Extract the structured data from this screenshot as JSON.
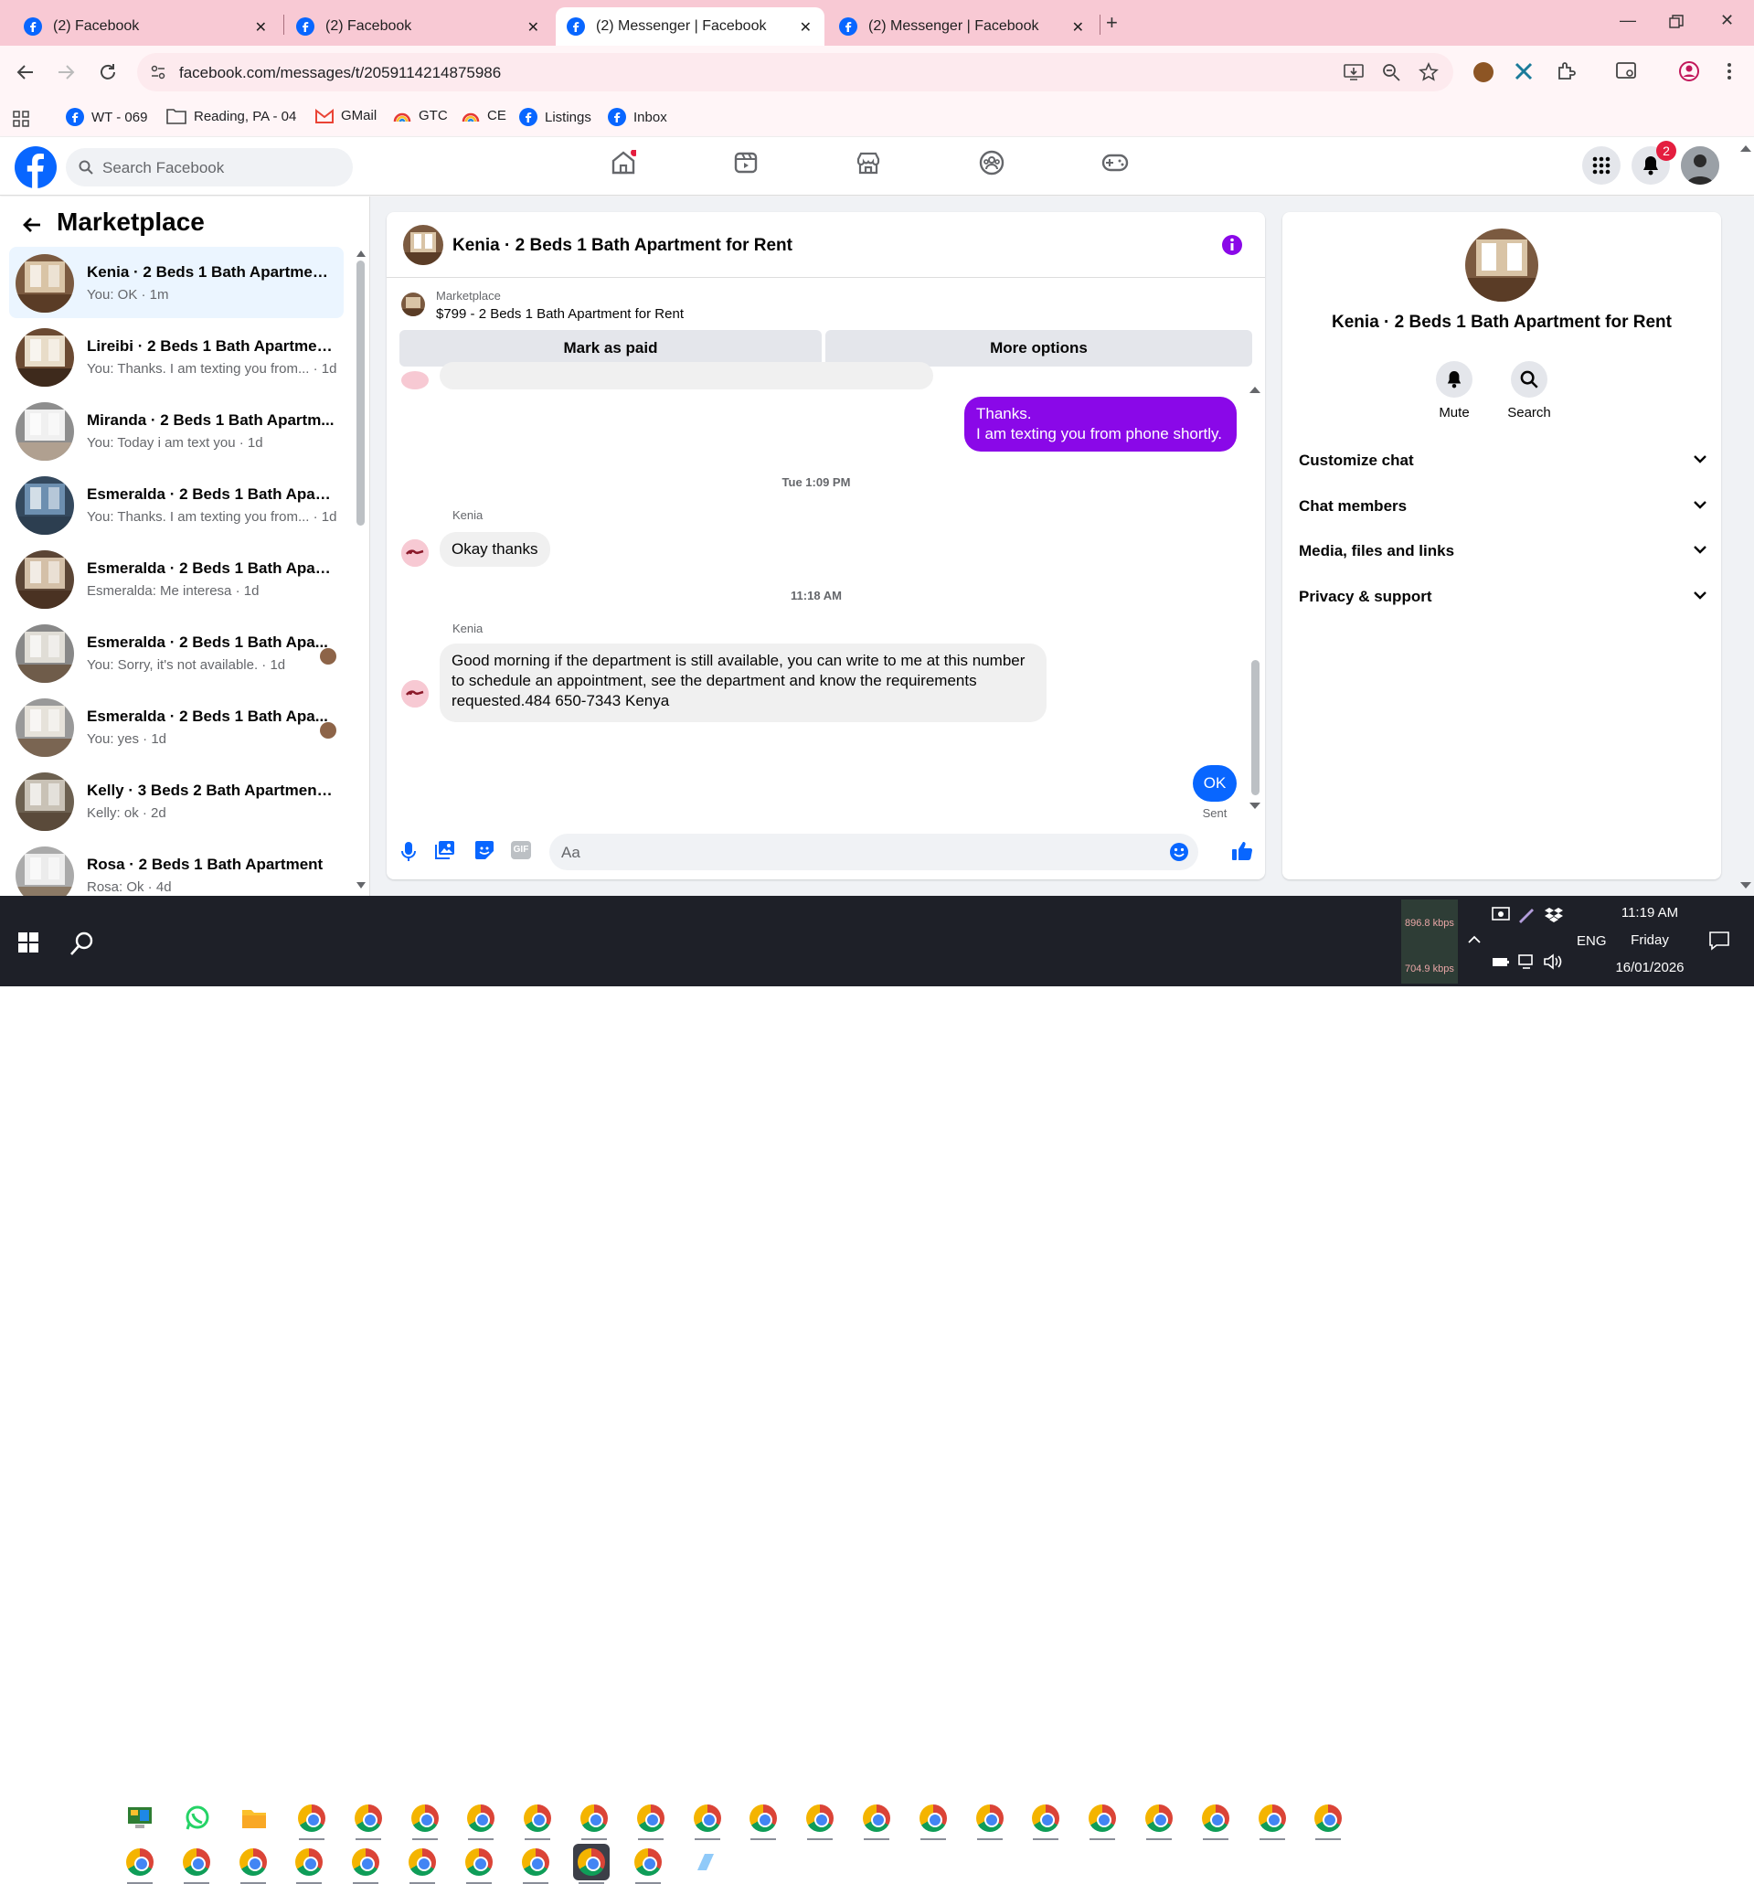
{
  "browser": {
    "tabs": [
      {
        "title": "(2) Facebook",
        "active": false
      },
      {
        "title": "(2) Facebook",
        "active": false
      },
      {
        "title": "(2) Messenger | Facebook",
        "active": true
      },
      {
        "title": "(2) Messenger | Facebook",
        "active": false
      }
    ],
    "url": "facebook.com/messages/t/2059114214875986",
    "bookmarks": [
      {
        "label": "WT - 069",
        "icon": "facebook-icon"
      },
      {
        "label": "Reading, PA - 04",
        "icon": "folder-icon"
      },
      {
        "label": "GMail",
        "icon": "gmail-icon"
      },
      {
        "label": "GTC",
        "icon": "rainbow-icon"
      },
      {
        "label": "CE",
        "icon": "rainbow-icon"
      },
      {
        "label": "Listings",
        "icon": "facebook-icon"
      },
      {
        "label": "Inbox",
        "icon": "facebook-icon"
      }
    ]
  },
  "fb_header": {
    "search_placeholder": "Search Facebook",
    "notification_count": "2"
  },
  "marketplace": {
    "title": "Marketplace",
    "conversations": [
      {
        "title": "Kenia · 2 Beds 1 Bath Apartment...",
        "snippet": "You: OK · 1m",
        "active": true
      },
      {
        "title": "Lireibi · 2 Beds 1 Bath Apartmen...",
        "snippet": "You: Thanks. I am texting you from... · 1d"
      },
      {
        "title": "Miranda · 2 Beds 1 Bath Apartm...",
        "snippet": "You: Today i am text you · 1d"
      },
      {
        "title": "Esmeralda · 2 Beds 1 Bath Apart...",
        "snippet": "You: Thanks. I am texting you from... · 1d"
      },
      {
        "title": "Esmeralda · 2 Beds 1 Bath Apart...",
        "snippet": "Esmeralda: Me interesa · 1d"
      },
      {
        "title": "Esmeralda · 2 Beds 1 Bath Apa...",
        "snippet": "You: Sorry, it's not available. · 1d"
      },
      {
        "title": "Esmeralda · 2 Beds 1 Bath Apa...",
        "snippet": "You: yes · 1d"
      },
      {
        "title": "Kelly · 3 Beds 2 Bath Apartment ...",
        "snippet": "Kelly: ok · 2d"
      },
      {
        "title": "Rosa · 2 Beds 1 Bath Apartment",
        "snippet": "Rosa: Ok · 4d"
      }
    ]
  },
  "chat": {
    "title": "Kenia · 2 Beds 1 Bath Apartment for Rent",
    "marketplace_label": "Marketplace",
    "listing": "$799 - 2 Beds 1 Bath Apartment for Rent",
    "mark_paid": "Mark as paid",
    "more_options": "More options",
    "messages": {
      "out1_line1": "Thanks.",
      "out1_line2": "I am texting you from phone shortly.",
      "ts1": "Tue 1:09 PM",
      "sender1": "Kenia",
      "in1": "Okay thanks",
      "ts2": "11:18 AM",
      "sender2": "Kenia",
      "in2_line1": "Good morning if the department is still available, you can write to me at this number",
      "in2_line2": "to schedule an appointment, see the department and know the requirements",
      "in2_line3": "requested.484 650-7343 Kenya",
      "out2": "OK",
      "status": "Sent"
    },
    "input_placeholder": "Aa"
  },
  "info_panel": {
    "title": "Kenia · 2 Beds 1 Bath Apartment for Rent",
    "mute": "Mute",
    "search": "Search",
    "sections": [
      "Customize chat",
      "Chat members",
      "Media, files and links",
      "Privacy & support"
    ]
  },
  "taskbar": {
    "net_up": "896.8 kbps",
    "net_down": "704.9 kbps",
    "lang": "ENG",
    "time": "11:19 AM",
    "day": "Friday",
    "date": "16/01/2026"
  },
  "colors": {
    "accent_purple": "#8a08e8",
    "fb_blue": "#0866ff",
    "tab_bar": "#f8c9d4"
  }
}
